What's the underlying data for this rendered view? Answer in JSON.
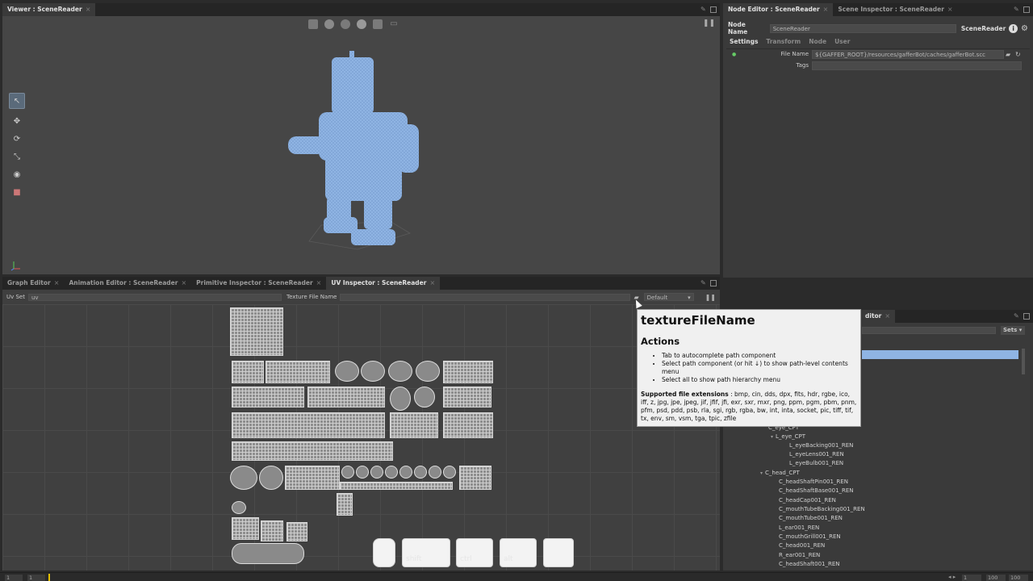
{
  "viewer": {
    "tab_label": "Viewer : SceneReader",
    "toolbar_icons": [
      "camera-icon",
      "display-icon",
      "shading-icon",
      "sphere-icon",
      "snapshot-icon",
      "expand-icon"
    ],
    "tools": [
      "select-tool-icon",
      "translate-tool-icon",
      "rotate-tool-icon",
      "scale-tool-icon",
      "camera-tool-icon",
      "crop-tool-icon"
    ],
    "model_color": "#8fb4e3"
  },
  "node_editor": {
    "tabs": [
      {
        "label": "Node Editor : SceneReader",
        "active": true
      },
      {
        "label": "Scene Inspector : SceneReader",
        "active": false
      }
    ],
    "node_name_label": "Node Name",
    "node_name_value": "SceneReader",
    "node_type": "SceneReader",
    "subtabs": [
      "Settings",
      "Transform",
      "Node",
      "User"
    ],
    "file_name_label": "File Name",
    "file_name_value": "${GAFFER_ROOT}/resources/gafferBot/caches/gafferBot.scc",
    "tags_label": "Tags",
    "tags_value": ""
  },
  "bottom_left": {
    "tabs": [
      {
        "label": "Graph Editor",
        "active": false
      },
      {
        "label": "Animation Editor : SceneReader",
        "active": false
      },
      {
        "label": "Primitive Inspector : SceneReader",
        "active": false
      },
      {
        "label": "UV Inspector : SceneReader",
        "active": true
      }
    ],
    "uv_set_label": "Uv Set",
    "uv_set_value": "uv",
    "texture_file_label": "Texture File Name",
    "texture_file_value": "",
    "display_mode": "Default",
    "keys": [
      "",
      "shift",
      "ctrl",
      "alt",
      ""
    ]
  },
  "bottom_right": {
    "tab_partial": "ditor",
    "sets_label": "Sets",
    "tree": [
      {
        "label": "C_eye_CPT",
        "indent": 1,
        "arrow": false
      },
      {
        "label": "L_eye_CPT",
        "indent": 2,
        "arrow": true
      },
      {
        "label": "L_eyeBacking001_REN",
        "indent": 3,
        "arrow": false
      },
      {
        "label": "L_eyeLens001_REN",
        "indent": 3,
        "arrow": false
      },
      {
        "label": "L_eyeBulb001_REN",
        "indent": 3,
        "arrow": false
      },
      {
        "label": "C_head_CPT",
        "indent": 1,
        "arrow": true
      },
      {
        "label": "C_headShaftPin001_REN",
        "indent": 2,
        "arrow": false
      },
      {
        "label": "C_headShaftBase001_REN",
        "indent": 2,
        "arrow": false
      },
      {
        "label": "C_headCap001_REN",
        "indent": 2,
        "arrow": false
      },
      {
        "label": "C_mouthTubeBacking001_REN",
        "indent": 2,
        "arrow": false
      },
      {
        "label": "C_mouthTube001_REN",
        "indent": 2,
        "arrow": false
      },
      {
        "label": "L_ear001_REN",
        "indent": 2,
        "arrow": false
      },
      {
        "label": "C_mouthGrill001_REN",
        "indent": 2,
        "arrow": false
      },
      {
        "label": "C_head001_REN",
        "indent": 2,
        "arrow": false
      },
      {
        "label": "R_ear001_REN",
        "indent": 2,
        "arrow": false
      },
      {
        "label": "C_headShaft001_REN",
        "indent": 2,
        "arrow": false
      }
    ]
  },
  "tooltip": {
    "title": "textureFileName",
    "actions_heading": "Actions",
    "actions": [
      "Tab to autocomplete path component",
      "Select path component (or hit ↓) to show path-level contents menu",
      "Select all to show path hierarchy menu"
    ],
    "extensions_label": "Supported file extensions",
    "extensions_value": " : bmp, cin, dds, dpx, fits, hdr, rgbe, ico, iff, z, jpg, jpe, jpeg, jif, jfif, jfi, exr, sxr, mxr, png, ppm, pgm, pbm, pnm, pfm, psd, pdd, psb, rla, sgi, rgb, rgba, bw, int, inta, socket, pic, tiff, tif, tx, env, sm, vsm, tga, tpic, zfile"
  },
  "timeline": {
    "start": "1",
    "current": "1",
    "end_a": "1",
    "end_b": "100",
    "end_c": "100"
  }
}
